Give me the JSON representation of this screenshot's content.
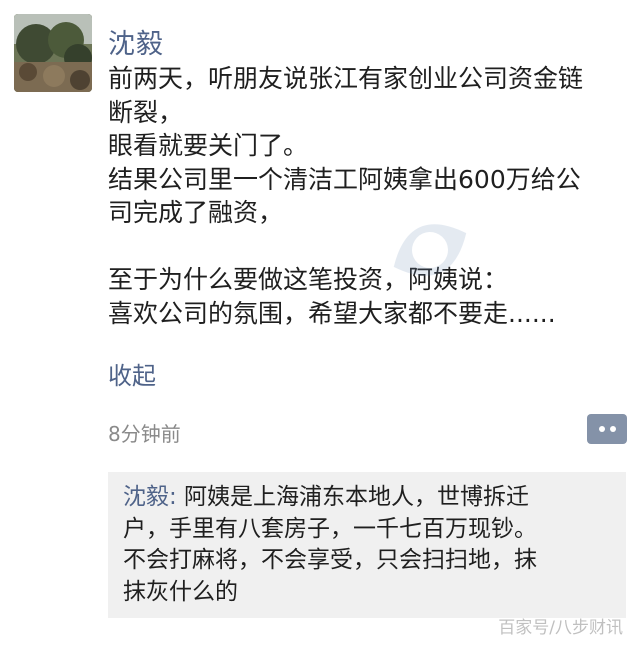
{
  "post": {
    "author": "沈毅",
    "body_lines": [
      "前两天，听朋友说张江有家创业公司资金链",
      "断裂，",
      "眼看就要关门了。",
      "结果公司里一个清洁工阿姨拿出600万给公",
      "司完成了融资，",
      "",
      "至于为什么要做这笔投资，阿姨说：",
      "喜欢公司的氛围，希望大家都不要走......"
    ],
    "collapse_label": "收起",
    "timestamp": "8分钟前"
  },
  "comment": {
    "author": "沈毅:",
    "lines": [
      " 阿姨是上海浦东本地人，世博拆迁",
      "户，手里有八套房子，一千七百万现钞。",
      "不会打麻将，不会享受，只会扫扫地，抹",
      "抹灰什么的"
    ]
  },
  "watermark": {
    "text": "百家号/八步财讯"
  },
  "icons": {
    "avatar": "avatar-landscape-photo",
    "more": "more-dots-icon"
  },
  "colors": {
    "author_link": "#4f6389",
    "comment_background": "#f0f0f0",
    "more_button": "#8492a8",
    "timestamp": "#8a8a8a"
  }
}
